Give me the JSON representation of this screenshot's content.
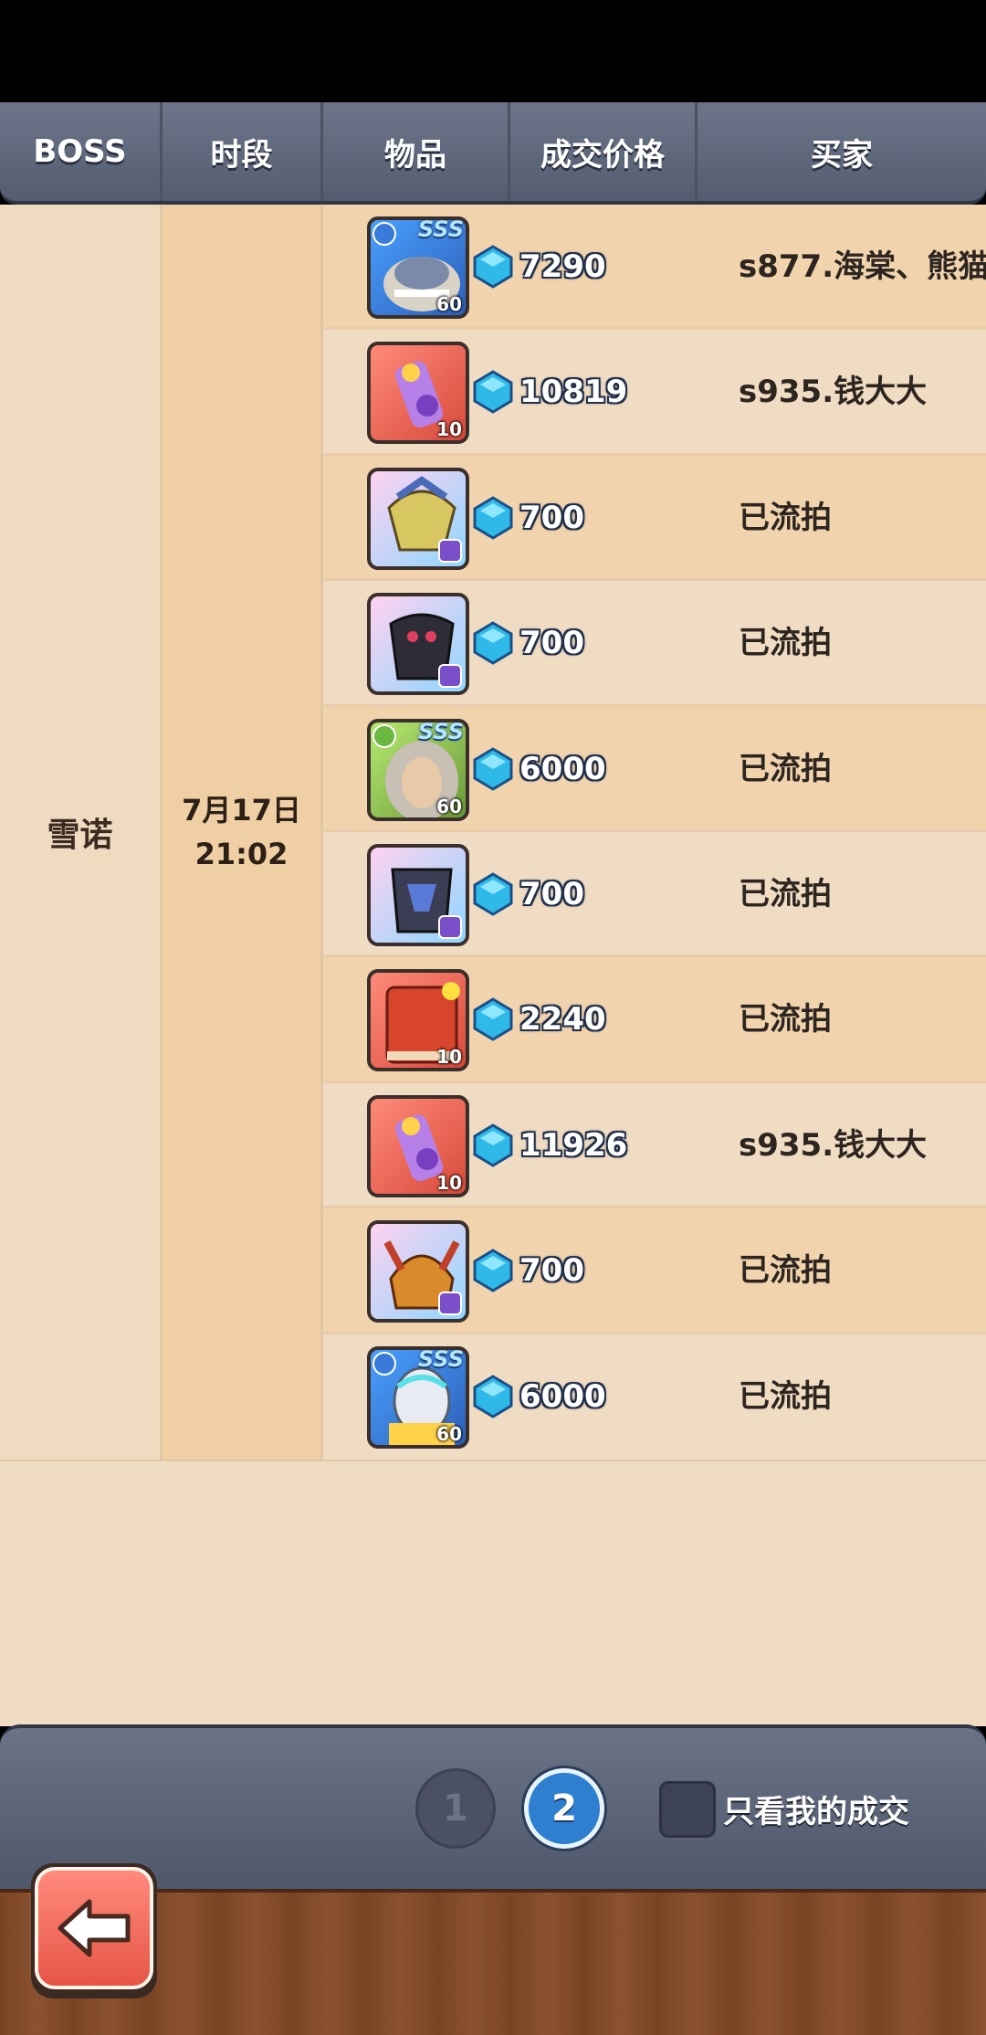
{
  "header": {
    "col_boss": "BOSS",
    "col_time": "时段",
    "col_item": "物品",
    "col_price": "成交价格",
    "col_buyer": "买家"
  },
  "group": {
    "boss": "雪诺",
    "date": "7月17日",
    "time": "21:02"
  },
  "rows": [
    {
      "price": "7290",
      "buyer": "s877.海棠、熊猫",
      "level": "60",
      "sss": "SSS"
    },
    {
      "price": "10819",
      "buyer": "s935.钱大大",
      "level": "10"
    },
    {
      "price": "700",
      "buyer": "已流拍"
    },
    {
      "price": "700",
      "buyer": "已流拍"
    },
    {
      "price": "6000",
      "buyer": "已流拍",
      "level": "60",
      "sss": "SSS"
    },
    {
      "price": "700",
      "buyer": "已流拍"
    },
    {
      "price": "2240",
      "buyer": "已流拍",
      "level": "10"
    },
    {
      "price": "11926",
      "buyer": "s935.钱大大",
      "level": "10"
    },
    {
      "price": "700",
      "buyer": "已流拍"
    },
    {
      "price": "6000",
      "buyer": "已流拍",
      "level": "60",
      "sss": "SSS"
    }
  ],
  "pagination": {
    "page1": "1",
    "page2": "2",
    "current": 2
  },
  "filter": {
    "only_mine_label": "只看我的成交",
    "checked": false
  },
  "colors": {
    "header": "#5e667a",
    "gem": "#2fb9e8",
    "accent_back": "#e65546"
  }
}
